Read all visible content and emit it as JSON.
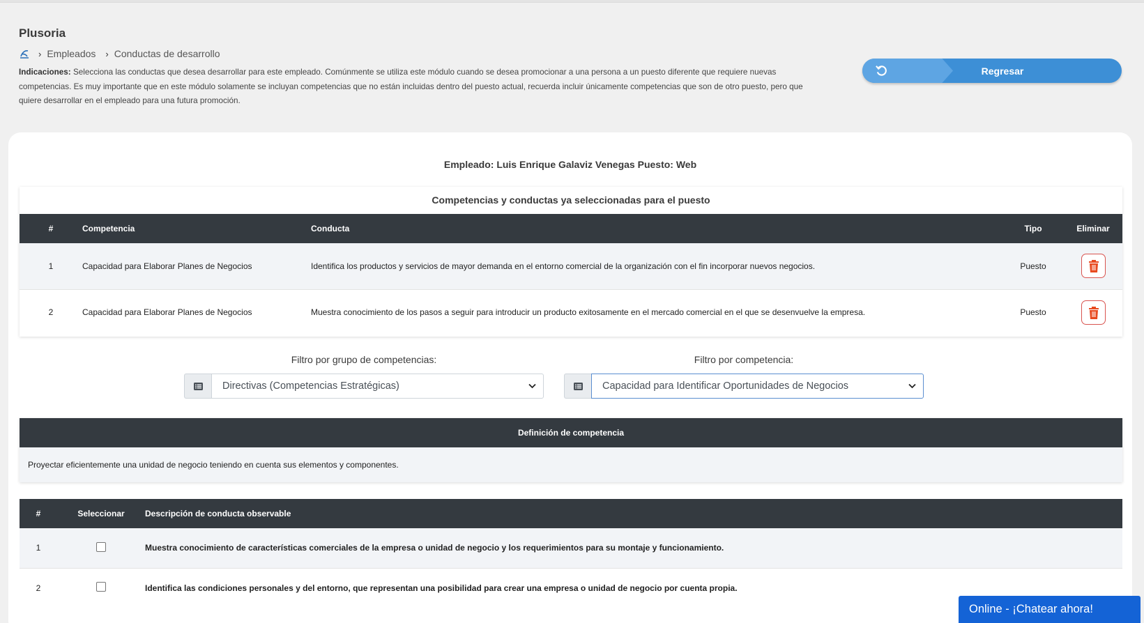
{
  "app": {
    "title": "Plusoria"
  },
  "breadcrumb": {
    "items": [
      "Empleados",
      "Conductas de desarrollo"
    ]
  },
  "indications": {
    "label": "Indicaciones:",
    "text": "Selecciona las conductas que desea desarrollar para este empleado. Comúnmente se utiliza este módulo cuando se desea promocionar a una persona a un puesto diferente que requiere nuevas competencias. Es muy importante que en este módulo solamente se incluyan competencias que no están incluidas dentro del puesto actual, recuerda incluir únicamente competencias que son de otro puesto, pero que quiere desarrollar en el empleado para una futura promoción."
  },
  "back_button": {
    "label": "Regresar"
  },
  "employee_line": "Empleado: Luis Enrique Galaviz Venegas Puesto: Web",
  "selected": {
    "caption": "Competencias y conductas ya seleccionadas para el puesto",
    "headers": {
      "num": "#",
      "competencia": "Competencia",
      "conducta": "Conducta",
      "tipo": "Tipo",
      "eliminar": "Eliminar"
    },
    "rows": [
      {
        "num": "1",
        "competencia": "Capacidad para Elaborar Planes de Negocios",
        "conducta": "Identifica los productos y servicios de mayor demanda en el entorno comercial de la organización con el fin incorporar nuevos negocios.",
        "tipo": "Puesto"
      },
      {
        "num": "2",
        "competencia": "Capacidad para Elaborar Planes de Negocios",
        "conducta": "Muestra conocimiento de los pasos a seguir para introducir un producto exitosamente en el mercado comercial en el que se desenvuelve la empresa.",
        "tipo": "Puesto"
      }
    ]
  },
  "filters": {
    "group": {
      "label": "Filtro por grupo de competencias:",
      "value": "Directivas (Competencias Estratégicas)"
    },
    "competence": {
      "label": "Filtro por competencia:",
      "value": "Capacidad para Identificar Oportunidades de Negocios"
    }
  },
  "definition": {
    "header": "Definición de competencia",
    "text": "Proyectar eficientemente una unidad de negocio teniendo en cuenta sus elementos y componentes."
  },
  "conducts": {
    "headers": {
      "num": "#",
      "select": "Seleccionar",
      "desc": "Descripción de conducta observable"
    },
    "rows": [
      {
        "num": "1",
        "desc": "Muestra conocimiento de características comerciales de la empresa o unidad de negocio y los requerimientos para su montaje y funcionamiento."
      },
      {
        "num": "2",
        "desc": "Identifica las condiciones personales y del entorno, que representan una posibilidad para crear una empresa o unidad de negocio por cuenta propia."
      }
    ]
  },
  "chat": {
    "label": "Online - ¡Chatear ahora!"
  },
  "colors": {
    "primary": "#3d8fd6",
    "header_dark": "#343a40",
    "danger": "#d9534f",
    "chat": "#1463d6"
  }
}
